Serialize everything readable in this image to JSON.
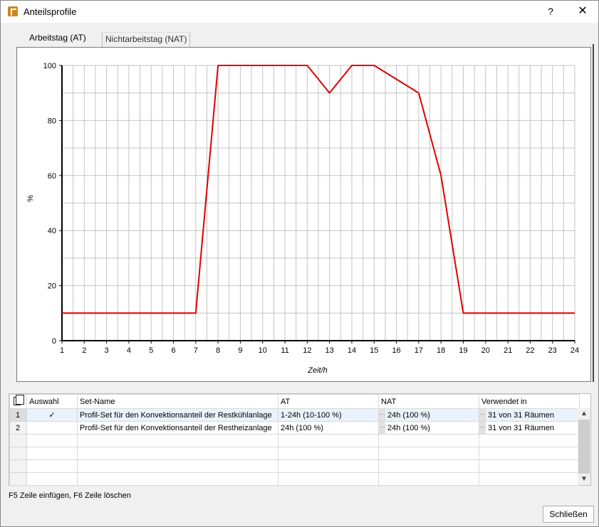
{
  "window": {
    "title": "Anteilsprofile",
    "help": "?",
    "close": "✕"
  },
  "tabs": [
    {
      "label": "Arbeitstag (AT)",
      "active": true
    },
    {
      "label": "Nichtarbeitstag (NAT)",
      "active": false
    }
  ],
  "chart_data": {
    "type": "line",
    "title": "",
    "xlabel": "Zeit/h",
    "ylabel": "%",
    "xlim": [
      1,
      24
    ],
    "ylim": [
      0,
      100
    ],
    "x_ticks": [
      1,
      2,
      3,
      4,
      5,
      6,
      7,
      8,
      9,
      10,
      11,
      12,
      13,
      14,
      15,
      16,
      17,
      18,
      19,
      20,
      21,
      22,
      23,
      24
    ],
    "y_ticks": [
      0,
      20,
      40,
      60,
      80,
      100
    ],
    "grid": true,
    "series": [
      {
        "color": "#e00000",
        "x": [
          1,
          7,
          8,
          12,
          13,
          14,
          15,
          17,
          18,
          19,
          24
        ],
        "y": [
          10,
          10,
          100,
          100,
          90,
          100,
          100,
          90,
          60,
          10,
          10
        ]
      }
    ]
  },
  "table": {
    "columns": [
      "Auswahl",
      "Set-Name",
      "AT",
      "NAT",
      "Verwendet in"
    ],
    "rows": [
      {
        "num": "1",
        "selected": "✓",
        "name": "Profil-Set für den Konvektionsanteil der Restkühlanlage",
        "at": "1-24h (10-100 %)",
        "nat": "24h (100 %)",
        "used": "31 von 31 Räumen"
      },
      {
        "num": "2",
        "selected": "",
        "name": "Profil-Set für den Konvektionsanteil der Restheizanlage",
        "at": "24h (100 %)",
        "nat": "24h (100 %)",
        "used": "31 von 31 Räumen"
      }
    ],
    "ellipsis": "···"
  },
  "hint": "F5 Zeile einfügen, F6 Zeile löschen",
  "close_button": "Schließen"
}
